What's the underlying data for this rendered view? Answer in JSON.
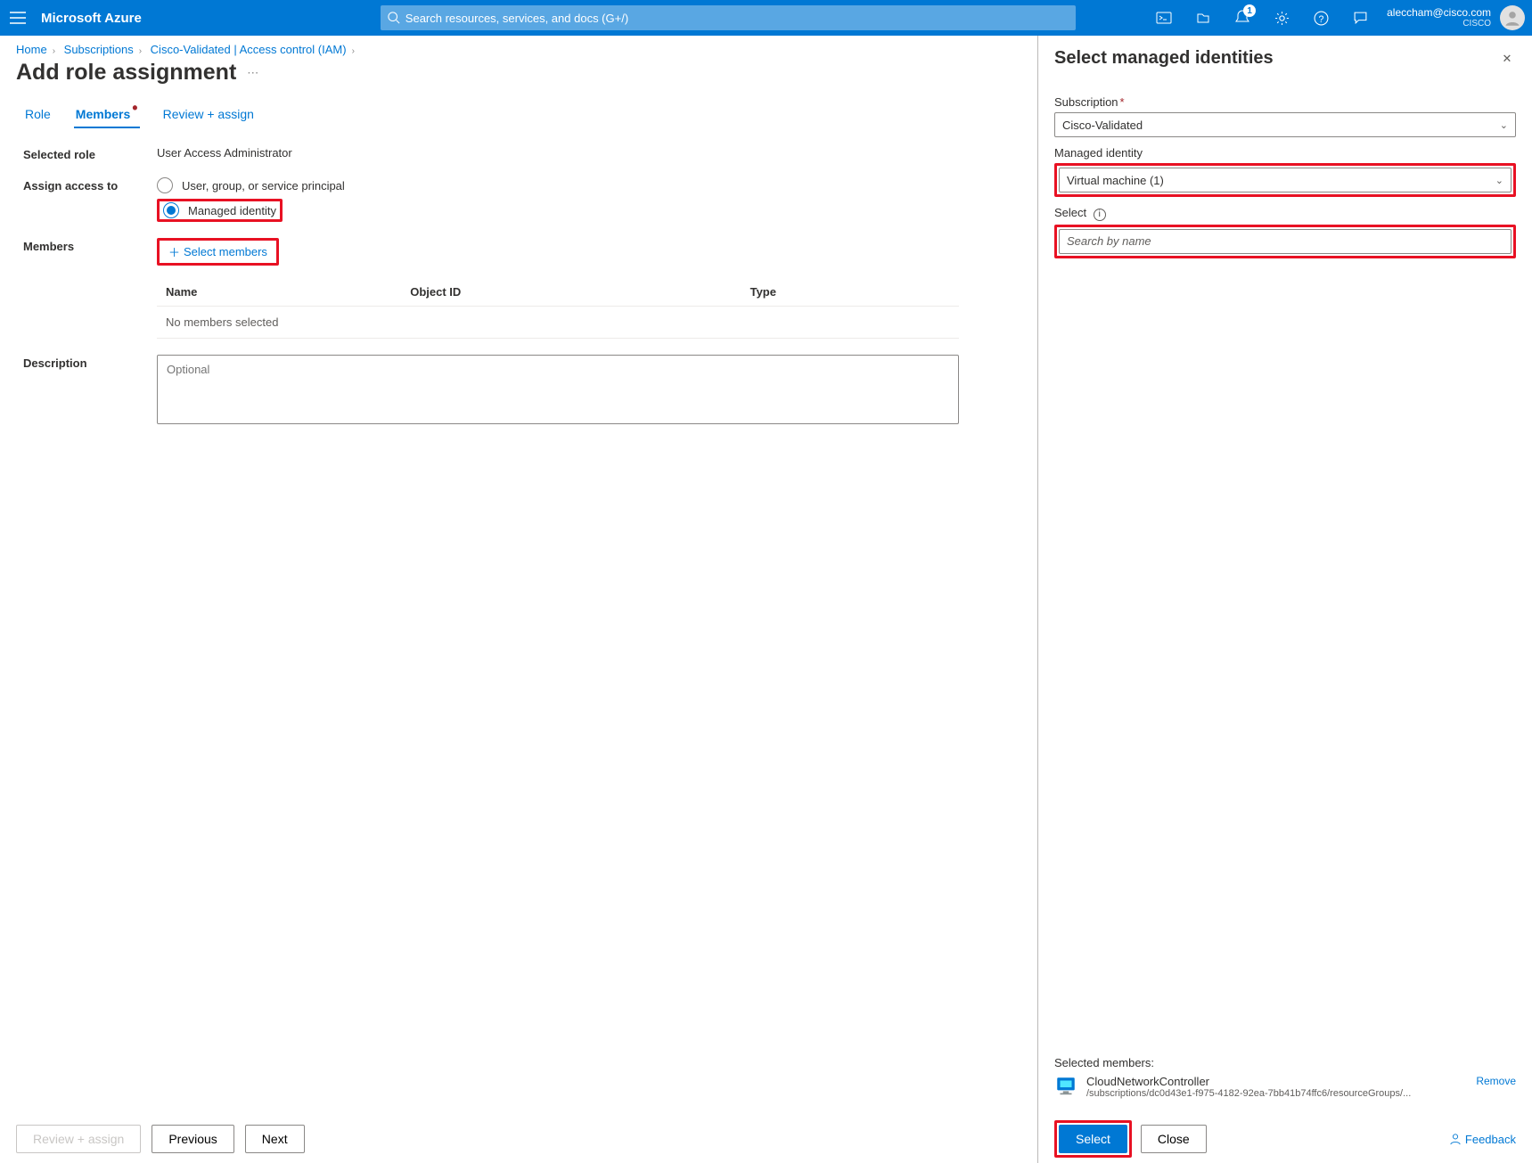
{
  "header": {
    "brand": "Microsoft Azure",
    "search_placeholder": "Search resources, services, and docs (G+/)",
    "notification_count": "1",
    "account_email": "aleccham@cisco.com",
    "account_org": "CISCO"
  },
  "breadcrumb": {
    "items": [
      "Home",
      "Subscriptions",
      "Cisco-Validated | Access control (IAM)"
    ]
  },
  "page": {
    "title": "Add role assignment",
    "tabs": [
      "Role",
      "Members",
      "Review + assign"
    ],
    "active_tab_index": 1,
    "selected_role_label": "Selected role",
    "selected_role_value": "User Access Administrator",
    "assign_label": "Assign access to",
    "assign_options": [
      "User, group, or service principal",
      "Managed identity"
    ],
    "assign_selected_index": 1,
    "members_label": "Members",
    "select_members_btn": "Select members",
    "table_headers": [
      "Name",
      "Object ID",
      "Type"
    ],
    "table_empty": "No members selected",
    "description_label": "Description",
    "description_placeholder": "Optional"
  },
  "footer": {
    "review": "Review + assign",
    "previous": "Previous",
    "next": "Next"
  },
  "panel": {
    "title": "Select managed identities",
    "subscription_label": "Subscription",
    "subscription_value": "Cisco-Validated",
    "managed_identity_label": "Managed identity",
    "managed_identity_value": "Virtual machine (1)",
    "select_label": "Select",
    "select_placeholder": "Search by name",
    "selected_members_label": "Selected members:",
    "member_name": "CloudNetworkController",
    "member_path": "/subscriptions/dc0d43e1-f975-4182-92ea-7bb41b74ffc6/resourceGroups/...",
    "remove_label": "Remove",
    "select_btn": "Select",
    "close_btn": "Close",
    "feedback": "Feedback"
  }
}
